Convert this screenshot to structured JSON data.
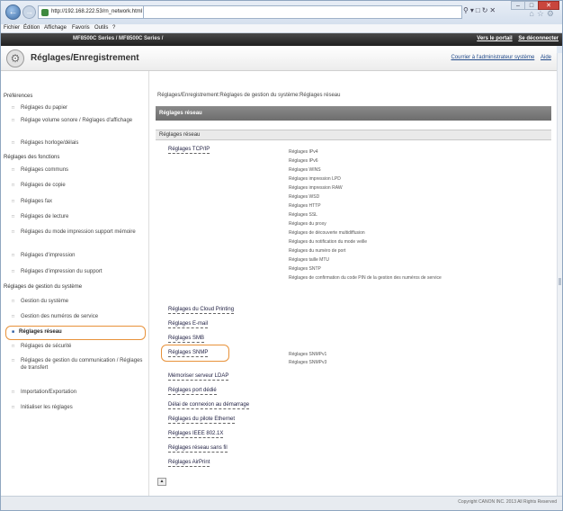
{
  "browser": {
    "address": "http://192.168.222.53/rn_network.html",
    "menu": [
      "Fichier",
      "Édition",
      "Affichage",
      "Favoris",
      "Outils",
      "?"
    ]
  },
  "header": {
    "model": "MF8500C Series / MF8500C Series /",
    "portal_link": "Vers le portail",
    "logout_link": "Se déconnecter"
  },
  "page": {
    "title": "Réglages/Enregistrement",
    "mail_admin": "Courrier à l'administrateur système",
    "help": "Aide"
  },
  "sidebar": {
    "items": [
      {
        "label": "Préférences",
        "kind": "head"
      },
      {
        "label": "Réglages du papier",
        "kind": "sub"
      },
      {
        "label": "Réglage volume sonore / Réglages d'affichage",
        "kind": "sub"
      },
      {
        "label": "Réglages horloge/délais",
        "kind": "sub"
      },
      {
        "label": "Réglages des fonctions",
        "kind": "head"
      },
      {
        "label": "Réglages communs",
        "kind": "sub"
      },
      {
        "label": "Réglages de copie",
        "kind": "sub"
      },
      {
        "label": "Réglages fax",
        "kind": "sub"
      },
      {
        "label": "Réglages de lecture",
        "kind": "sub"
      },
      {
        "label": "Réglages du mode impression support mémoire",
        "kind": "sub"
      },
      {
        "label": "Réglages d'impression",
        "kind": "sub"
      },
      {
        "label": "Réglages d'impression du support",
        "kind": "sub"
      },
      {
        "label": "Réglages de gestion du système",
        "kind": "head"
      },
      {
        "label": "Gestion du système",
        "kind": "sub"
      },
      {
        "label": "Gestion des numéros de service",
        "kind": "sub"
      },
      {
        "label": "Réglages réseau",
        "kind": "active"
      },
      {
        "label": "Réglages de sécurité",
        "kind": "sub"
      },
      {
        "label": "Réglages de gestion du communication / Réglages de transfert",
        "kind": "sub"
      },
      {
        "label": "Importation/Exportation",
        "kind": "sub"
      },
      {
        "label": "Initialiser les réglages",
        "kind": "sub"
      }
    ]
  },
  "main": {
    "breadcrumb": "Réglages/Enregistrement:Réglages de gestion du système:Réglages réseau",
    "banner": "Réglages réseau",
    "section": "Réglages réseau",
    "links": [
      "Réglages TCP/IP",
      "Réglages du Cloud Printing",
      "Réglages E-mail",
      "Réglages SMB",
      "Réglages SNMP",
      "Mémoriser serveur LDAP",
      "Réglages port dédié",
      "Délai de connexion au démarrage",
      "Réglages du pilote Ethernet",
      "Réglages IEEE 802.1X",
      "Réglages réseau sans fil",
      "Réglages AirPrint"
    ],
    "tcpip_items": [
      "Réglages IPv4",
      "Réglages IPv6",
      "Réglages WINS",
      "Réglages impression LPD",
      "Réglages impression RAW",
      "Réglages WSD",
      "Réglages HTTP",
      "Réglages SSL",
      "Réglages du proxy",
      "Réglages de découverte multidiffusion",
      "Réglages du notification du mode veille",
      "Réglages du numéro de port",
      "Réglages taille MTU",
      "Réglages SNTP",
      "Réglages de confirmation du code PIN de la gestion des numéros de service"
    ],
    "snmp_items": [
      "Réglages SNMPv1",
      "Réglages SNMPv3"
    ],
    "back_button": "▲"
  },
  "footer": {
    "copyright": "Copyright CANON INC. 2013 All Rights Reserved"
  }
}
